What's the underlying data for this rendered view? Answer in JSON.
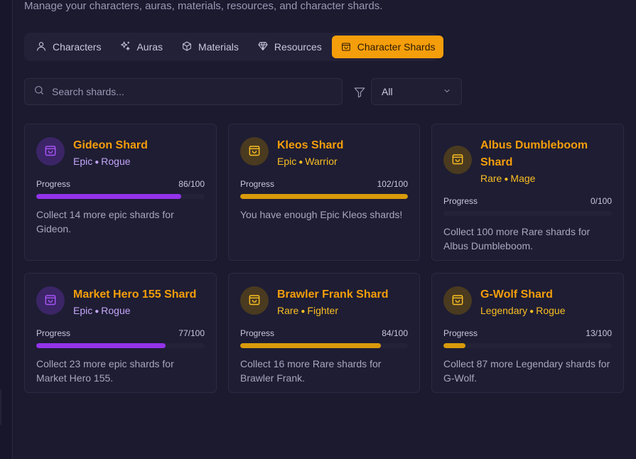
{
  "subtitle": "Manage your characters, auras, materials, resources, and character shards.",
  "tabs": [
    {
      "label": "Characters",
      "icon": "user-icon",
      "active": false
    },
    {
      "label": "Auras",
      "icon": "sparkles-icon",
      "active": false
    },
    {
      "label": "Materials",
      "icon": "box-icon",
      "active": false
    },
    {
      "label": "Resources",
      "icon": "gem-icon",
      "active": false
    },
    {
      "label": "Character Shards",
      "icon": "shopping-bag-icon",
      "active": true
    }
  ],
  "search": {
    "placeholder": "Search shards...",
    "value": ""
  },
  "filter": {
    "selected": "All"
  },
  "colors": {
    "accent": "#f59e0b",
    "epic": "#9333ea",
    "gold": "#d99a0b",
    "background": "#1b1a2e"
  },
  "cards": [
    {
      "title": "Gideon Shard",
      "rarity": "Epic",
      "cls": "Rogue",
      "theme": "epic",
      "progress_label": "Progress",
      "progress_text": "86/100",
      "progress": 0.86,
      "description": "Collect 14 more epic shards for Gideon."
    },
    {
      "title": "Kleos Shard",
      "rarity": "Epic",
      "cls": "Warrior",
      "theme": "gold",
      "progress_label": "Progress",
      "progress_text": "102/100",
      "progress": 1.0,
      "description": "You have enough Epic Kleos shards!"
    },
    {
      "title": "Albus Dumbleboom Shard",
      "rarity": "Rare",
      "cls": "Mage",
      "theme": "gold",
      "progress_label": "Progress",
      "progress_text": "0/100",
      "progress": 0.0,
      "description": "Collect 100 more Rare shards for Albus Dumbleboom."
    },
    {
      "title": "Market Hero 155 Shard",
      "rarity": "Epic",
      "cls": "Rogue",
      "theme": "epic",
      "progress_label": "Progress",
      "progress_text": "77/100",
      "progress": 0.77,
      "description": "Collect 23 more epic shards for Market Hero 155."
    },
    {
      "title": "Brawler Frank Shard",
      "rarity": "Rare",
      "cls": "Fighter",
      "theme": "gold",
      "progress_label": "Progress",
      "progress_text": "84/100",
      "progress": 0.84,
      "description": "Collect 16 more Rare shards for Brawler Frank."
    },
    {
      "title": "G-Wolf Shard",
      "rarity": "Legendary",
      "cls": "Rogue",
      "theme": "gold",
      "progress_label": "Progress",
      "progress_text": "13/100",
      "progress": 0.13,
      "description": "Collect 87 more Legendary shards for G-Wolf."
    }
  ]
}
